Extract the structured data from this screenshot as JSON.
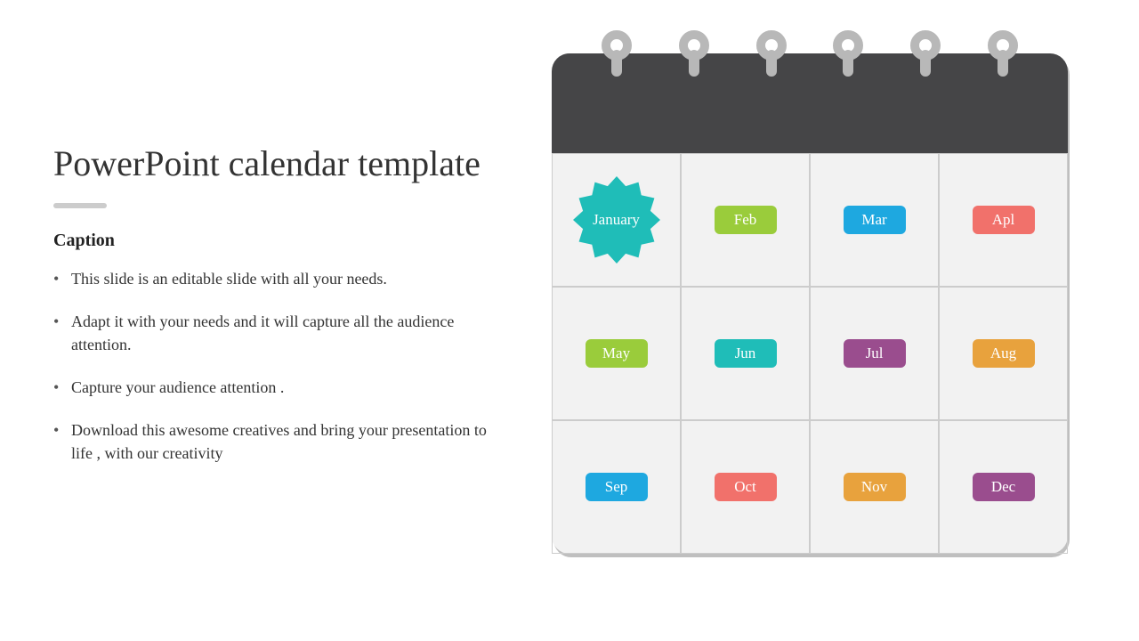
{
  "title": "PowerPoint calendar template",
  "caption_label": "Caption",
  "bullets": [
    "This slide is an editable slide with all your needs.",
    "Adapt it with your needs and it will capture all the audience attention.",
    "Capture your audience attention .",
    "Download this awesome creatives and bring your presentation to life , with our creativity"
  ],
  "months": [
    {
      "label": "January",
      "color": "#1fbdb8",
      "highlight": true
    },
    {
      "label": "Feb",
      "color": "#9acc3b"
    },
    {
      "label": "Mar",
      "color": "#1ea8e0"
    },
    {
      "label": "Apl",
      "color": "#f1716b"
    },
    {
      "label": "May",
      "color": "#9acc3b"
    },
    {
      "label": "Jun",
      "color": "#1fbdb8"
    },
    {
      "label": "Jul",
      "color": "#9a4d8e"
    },
    {
      "label": "Aug",
      "color": "#e8a23d"
    },
    {
      "label": "Sep",
      "color": "#1ea8e0"
    },
    {
      "label": "Oct",
      "color": "#f1716b"
    },
    {
      "label": "Nov",
      "color": "#e8a23d"
    },
    {
      "label": "Dec",
      "color": "#9a4d8e"
    }
  ]
}
